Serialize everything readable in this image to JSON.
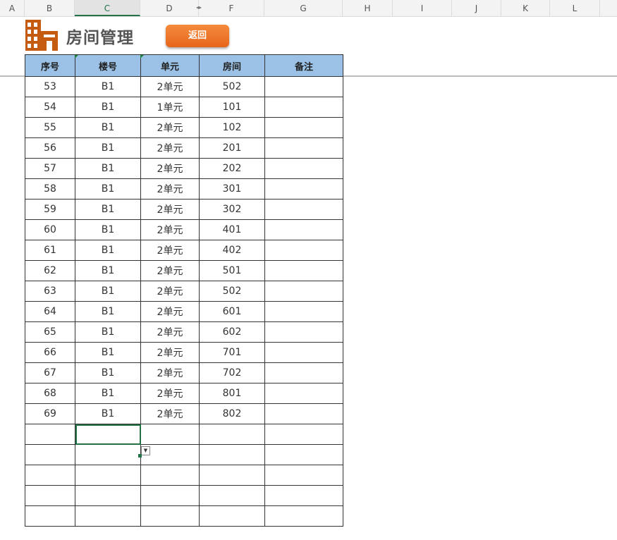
{
  "column_headers": [
    "A",
    "B",
    "C",
    "D",
    "F",
    "G",
    "H",
    "I",
    "J",
    "K",
    "L"
  ],
  "selected_column": "C",
  "title": "房间管理",
  "back_button": "返回",
  "table": {
    "headers": [
      "序号",
      "楼号",
      "单元",
      "房间",
      "备注"
    ],
    "rows": [
      [
        "53",
        "B1",
        "2单元",
        "502",
        ""
      ],
      [
        "54",
        "B1",
        "1单元",
        "101",
        ""
      ],
      [
        "55",
        "B1",
        "2单元",
        "102",
        ""
      ],
      [
        "56",
        "B1",
        "2单元",
        "201",
        ""
      ],
      [
        "57",
        "B1",
        "2单元",
        "202",
        ""
      ],
      [
        "58",
        "B1",
        "2单元",
        "301",
        ""
      ],
      [
        "59",
        "B1",
        "2单元",
        "302",
        ""
      ],
      [
        "60",
        "B1",
        "2单元",
        "401",
        ""
      ],
      [
        "61",
        "B1",
        "2单元",
        "402",
        ""
      ],
      [
        "62",
        "B1",
        "2单元",
        "501",
        ""
      ],
      [
        "63",
        "B1",
        "2单元",
        "502",
        ""
      ],
      [
        "64",
        "B1",
        "2单元",
        "601",
        ""
      ],
      [
        "65",
        "B1",
        "2单元",
        "602",
        ""
      ],
      [
        "66",
        "B1",
        "2单元",
        "701",
        ""
      ],
      [
        "67",
        "B1",
        "2单元",
        "702",
        ""
      ],
      [
        "68",
        "B1",
        "2单元",
        "801",
        ""
      ],
      [
        "69",
        "B1",
        "2单元",
        "802",
        ""
      ]
    ],
    "empty_rows": 5
  },
  "colors": {
    "header_fill": "#9bc2e6",
    "button": "#ee7628",
    "logo": "#c55a11",
    "selection": "#217346"
  },
  "icons": [
    "building-icon",
    "dropdown-arrow-icon"
  ]
}
